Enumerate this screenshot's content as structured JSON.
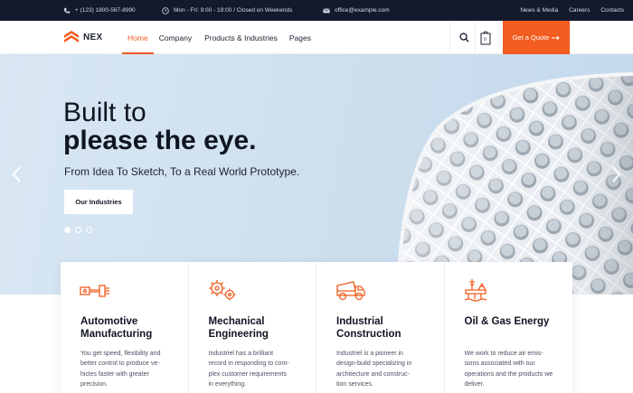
{
  "topbar": {
    "phone": "+ (123) 1800-567-8990",
    "hours": "Mon - Fri: 9:00 - 19:00 / Closed on Weekends",
    "email": "office@example.com",
    "links": [
      "News & Media",
      "Careers",
      "Contacts"
    ]
  },
  "nav": {
    "brand": "NEX",
    "menu": [
      "Home",
      "Company",
      "Products & Industries",
      "Pages"
    ],
    "active_index": 0,
    "cart_count": "0",
    "quote_label": "Get a Quote"
  },
  "hero": {
    "title_line1": "Built to",
    "title_line2": "please the eye.",
    "subtitle": "From Idea To Sketch, To a Real World Prototype.",
    "button_label": "Our Industries",
    "slides": 3,
    "current_slide": 1
  },
  "services": [
    {
      "icon": "piston-icon",
      "title": "Automotive Manufacturing",
      "desc": [
        "You get speed, flexibility and",
        "better control to produce ve-",
        "hicles faster with greater",
        "precision."
      ]
    },
    {
      "icon": "gears-icon",
      "title": "Mechanical Engineering",
      "desc": [
        "Industriel has a brilliant",
        "record in responding to com-",
        "plex customer requirements",
        "in everything."
      ]
    },
    {
      "icon": "dump-truck-icon",
      "title": "Industrial Construction",
      "desc": [
        "Industriel is a pioneer in",
        "design-build specializing in",
        "architecture and construc-",
        "tion services."
      ]
    },
    {
      "icon": "oil-rig-icon",
      "title": "Oil & Gas Energy",
      "desc": [
        "We work to reduce air emis-",
        "sions associated with our",
        "operations and the products we",
        "deliver."
      ]
    }
  ],
  "colors": {
    "accent": "#f25c1f",
    "topbar_bg": "#121a2c",
    "text_dark": "#101522"
  }
}
